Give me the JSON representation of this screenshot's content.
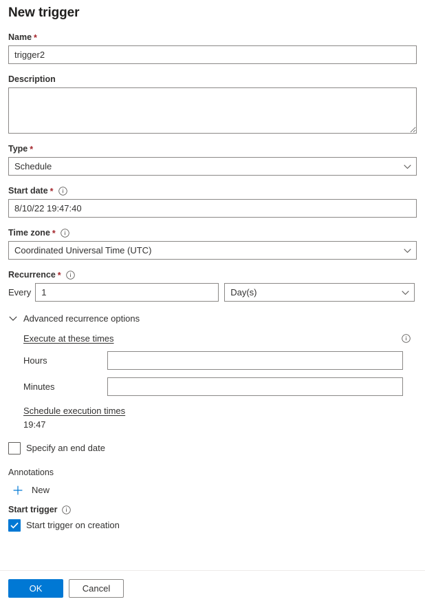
{
  "page": {
    "title": "New trigger"
  },
  "fields": {
    "name": {
      "label": "Name",
      "required": "*",
      "value": "trigger2"
    },
    "description": {
      "label": "Description",
      "value": ""
    },
    "type": {
      "label": "Type",
      "required": "*",
      "value": "Schedule"
    },
    "start_date": {
      "label": "Start date",
      "required": "*",
      "value": "8/10/22 19:47:40"
    },
    "time_zone": {
      "label": "Time zone",
      "required": "*",
      "value": "Coordinated Universal Time (UTC)"
    },
    "recurrence": {
      "label": "Recurrence",
      "required": "*",
      "every_label": "Every",
      "interval_value": "1",
      "unit_value": "Day(s)"
    }
  },
  "advanced": {
    "toggle_label": "Advanced recurrence options",
    "execute_title": "Execute at these times",
    "hours": {
      "label": "Hours",
      "value": ""
    },
    "minutes": {
      "label": "Minutes",
      "value": ""
    },
    "schedule_link": "Schedule execution times",
    "schedule_value": "19:47",
    "end_date_checkbox": {
      "label": "Specify an end date",
      "checked": false
    }
  },
  "annotations": {
    "label": "Annotations",
    "new_label": "New"
  },
  "start_trigger": {
    "label": "Start trigger",
    "checkbox_label": "Start trigger on creation",
    "checked": true
  },
  "footer": {
    "ok_label": "OK",
    "cancel_label": "Cancel"
  },
  "colors": {
    "accent": "#0078d4",
    "required_asterisk": "#a4262c",
    "border": "#8a8886",
    "text": "#323130"
  }
}
